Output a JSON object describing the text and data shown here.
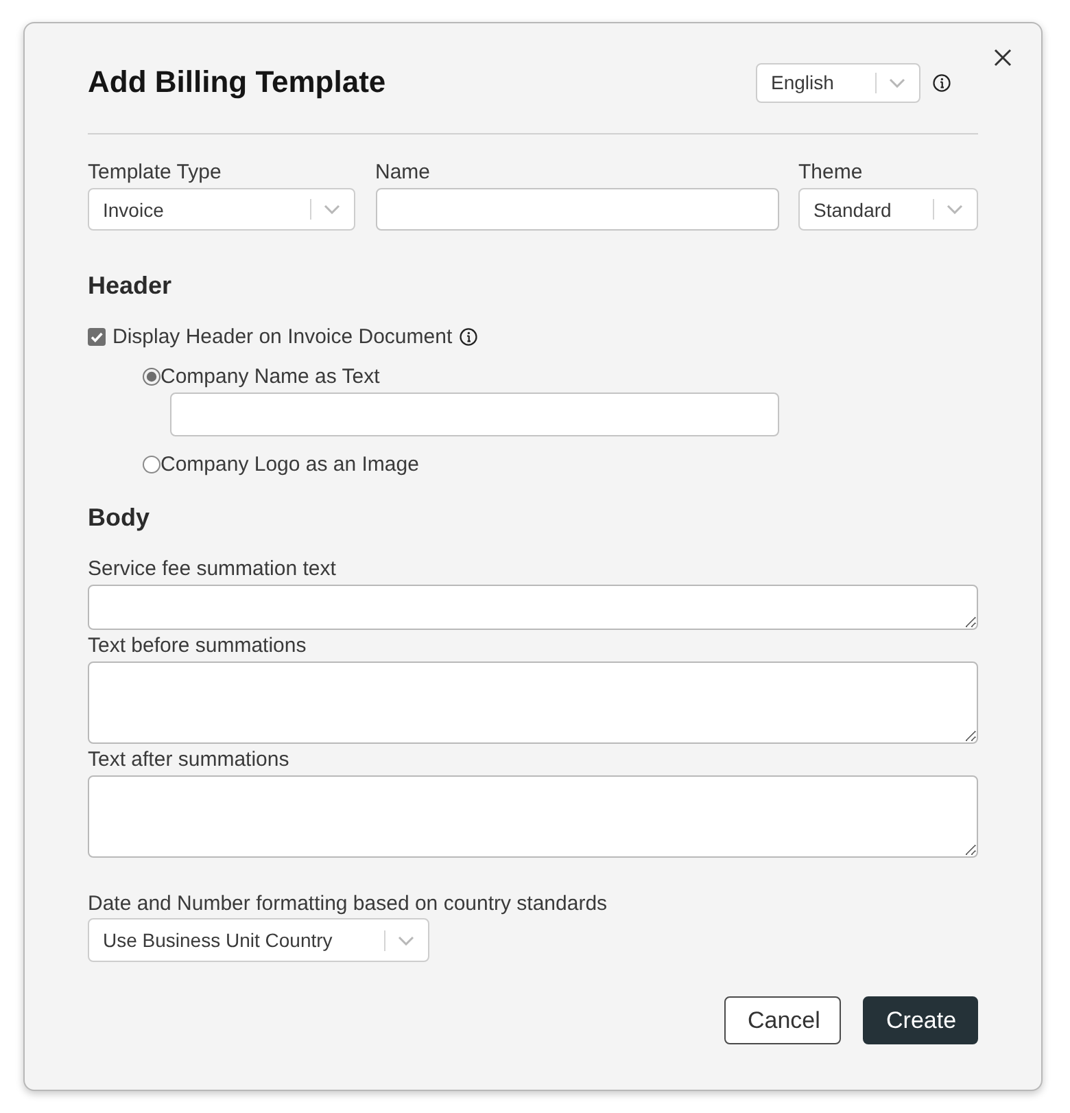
{
  "dialog": {
    "title": "Add Billing Template",
    "language_select": {
      "value": "English"
    }
  },
  "fields": [
    {
      "label": "Template Type",
      "kind": "select",
      "value": "Invoice"
    },
    {
      "label": "Name",
      "kind": "text"
    },
    {
      "label": "Theme",
      "kind": "select",
      "value": "Standard"
    }
  ],
  "header": {
    "heading": "Header",
    "display_header": {
      "label": "Display Header on Invoice Document",
      "checked": true
    },
    "options": [
      {
        "label": "Company Name as Text",
        "selected": true,
        "kind": "with_field"
      },
      {
        "label": "Company Logo as an Image",
        "selected": false,
        "kind": "plain"
      }
    ]
  },
  "body": {
    "heading": "Body",
    "fields": [
      {
        "label": "Service fee summation text",
        "kind": "short"
      },
      {
        "label": "Text before summations",
        "kind": "tall"
      },
      {
        "label": "Text after summations",
        "kind": "tall"
      }
    ]
  },
  "formatting": {
    "label": "Date and Number formatting based on country standards",
    "value": "Use Business Unit Country"
  },
  "buttons": [
    {
      "label": "Cancel",
      "kind": "secondary"
    },
    {
      "label": "Create",
      "kind": "primary"
    }
  ]
}
